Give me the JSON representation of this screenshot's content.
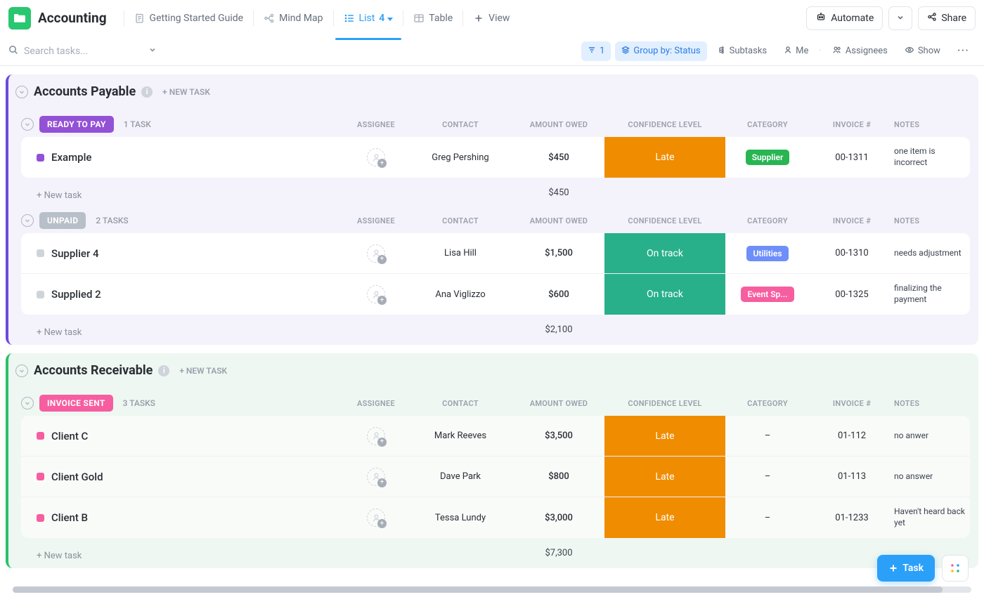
{
  "header": {
    "title": "Accounting",
    "views": [
      {
        "label": "Getting Started Guide"
      },
      {
        "label": "Mind Map"
      },
      {
        "label": "List",
        "badge": "4"
      },
      {
        "label": "Table"
      },
      {
        "label": "View"
      }
    ],
    "automate": "Automate",
    "share": "Share"
  },
  "toolbar": {
    "search_placeholder": "Search tasks...",
    "filter_count": "1",
    "groupby": "Group by: Status",
    "subtasks": "Subtasks",
    "me": "Me",
    "assignees": "Assignees",
    "show": "Show"
  },
  "columns": {
    "assignee": "ASSIGNEE",
    "contact": "CONTACT",
    "amount": "AMOUNT OWED",
    "confidence": "CONFIDENCE LEVEL",
    "category": "CATEGORY",
    "invoice": "INVOICE #",
    "notes": "NOTES"
  },
  "sections": [
    {
      "title": "Accounts Payable",
      "new_task": "+ NEW TASK",
      "class": "payable",
      "groups": [
        {
          "label": "READY TO PAY",
          "pill": "ready",
          "count": "1 TASK",
          "rows": [
            {
              "name": "Example",
              "contact": "Greg Pershing",
              "amount": "$450",
              "confidence": "Late",
              "conf_class": "late",
              "category": "Supplier",
              "cat_class": "supplier",
              "invoice": "00-1311",
              "notes": "one item is incorrect",
              "sq": "purple"
            }
          ],
          "total": "$450",
          "new": "+ New task"
        },
        {
          "label": "UNPAID",
          "pill": "unpaid",
          "count": "2 TASKS",
          "rows": [
            {
              "name": "Supplier 4",
              "contact": "Lisa Hill",
              "amount": "$1,500",
              "confidence": "On track",
              "conf_class": "ontrack",
              "category": "Utilities",
              "cat_class": "utilities",
              "invoice": "00-1310",
              "notes": "needs adjustment",
              "sq": "grey"
            },
            {
              "name": "Supplied 2",
              "contact": "Ana Viglizzo",
              "amount": "$600",
              "confidence": "On track",
              "conf_class": "ontrack",
              "category": "Event Sp...",
              "cat_class": "event",
              "invoice": "00-1325",
              "notes": "finalizing the payment",
              "sq": "grey"
            }
          ],
          "total": "$2,100",
          "new": "+ New task"
        }
      ]
    },
    {
      "title": "Accounts Receivable",
      "new_task": "+ NEW TASK",
      "class": "receivable",
      "groups": [
        {
          "label": "INVOICE SENT",
          "pill": "invoice",
          "count": "3 TASKS",
          "rows": [
            {
              "name": "Client C",
              "contact": "Mark Reeves",
              "amount": "$3,500",
              "confidence": "Late",
              "conf_class": "late",
              "category": "–",
              "cat_class": "",
              "invoice": "01-112",
              "notes": "no anwer",
              "sq": "pink"
            },
            {
              "name": "Client Gold",
              "contact": "Dave Park",
              "amount": "$800",
              "confidence": "Late",
              "conf_class": "late",
              "category": "–",
              "cat_class": "",
              "invoice": "01-113",
              "notes": "no answer",
              "sq": "pink"
            },
            {
              "name": "Client B",
              "contact": "Tessa Lundy",
              "amount": "$3,000",
              "confidence": "Late",
              "conf_class": "late",
              "category": "–",
              "cat_class": "",
              "invoice": "01-1233",
              "notes": "Haven't heard back yet",
              "sq": "pink"
            }
          ],
          "total": "$7,300",
          "new": "+ New task"
        }
      ]
    }
  ],
  "fab": {
    "task": "Task"
  }
}
